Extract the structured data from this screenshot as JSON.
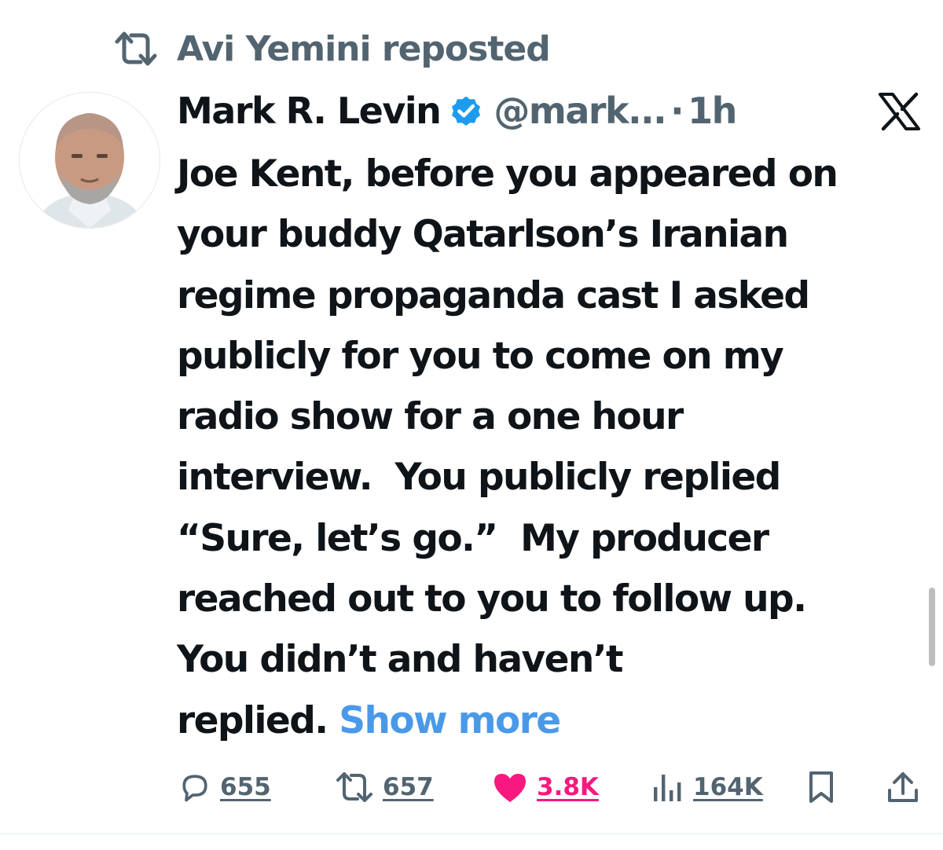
{
  "repost": {
    "icon": "repost-icon",
    "text": "Avi Yemini reposted"
  },
  "tweet": {
    "author": {
      "name": "Mark R. Levin",
      "verified_icon": "verified-badge-icon",
      "handle": "@mark...",
      "separator": "·",
      "time": "1h"
    },
    "platform_icon": "x-logo-icon",
    "body_lines": [
      "Joe Kent, before you appeared on",
      "your buddy Qatarlson’s Iranian",
      "regime propaganda cast I asked",
      "publicly for you to come on my",
      "radio show for a one hour",
      "interview.  You publicly replied",
      "“Sure, let’s go.”  My producer",
      "reached out to you to follow up.",
      "You didn’t and haven’t"
    ],
    "last_line": "replied.",
    "show_more": "Show more"
  },
  "actions": {
    "replies": {
      "icon": "reply-icon",
      "count": "655"
    },
    "reposts": {
      "icon": "repost-icon",
      "count": "657"
    },
    "likes": {
      "icon": "heart-icon",
      "count": "3.8K",
      "liked": true
    },
    "views": {
      "icon": "views-icon",
      "count": "164K"
    },
    "bookmark": {
      "icon": "bookmark-icon"
    },
    "share": {
      "icon": "share-icon"
    }
  },
  "colors": {
    "text": "#0f1419",
    "secondary": "#536471",
    "link": "#4a99e9",
    "verified": "#1d9bf0",
    "like": "#f91880"
  }
}
